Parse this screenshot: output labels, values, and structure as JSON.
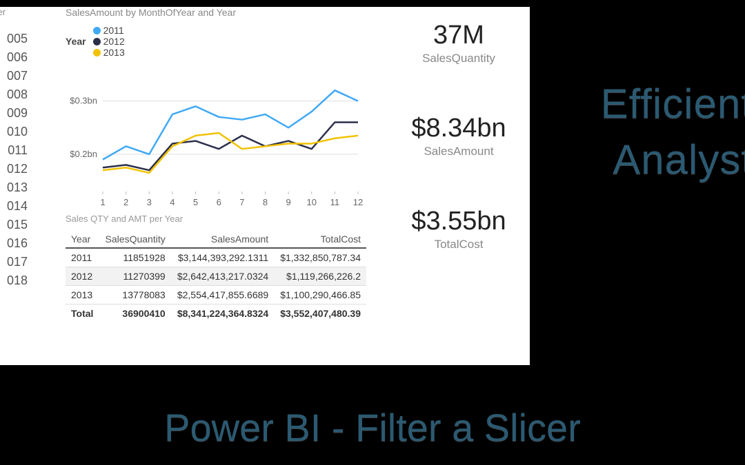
{
  "slicer": {
    "title": "cer",
    "years": [
      "005",
      "006",
      "007",
      "008",
      "009",
      "010",
      "011",
      "012",
      "013",
      "014",
      "015",
      "016",
      "017",
      "018"
    ]
  },
  "chart_title": "SalesAmount by MonthOfYear and Year",
  "legend": {
    "label": "Year",
    "items": [
      "2011",
      "2012",
      "2013"
    ]
  },
  "chart_data": {
    "type": "line",
    "x": [
      1,
      2,
      3,
      4,
      5,
      6,
      7,
      8,
      9,
      10,
      11,
      12
    ],
    "series": [
      {
        "name": "2011",
        "color": "#3fa9f5",
        "values": [
          0.19,
          0.215,
          0.2,
          0.275,
          0.29,
          0.27,
          0.265,
          0.275,
          0.25,
          0.28,
          0.32,
          0.3
        ]
      },
      {
        "name": "2012",
        "color": "#2b2f4a",
        "values": [
          0.175,
          0.18,
          0.17,
          0.22,
          0.225,
          0.21,
          0.235,
          0.215,
          0.225,
          0.21,
          0.26,
          0.26
        ]
      },
      {
        "name": "2013",
        "color": "#f2c200",
        "values": [
          0.17,
          0.175,
          0.165,
          0.215,
          0.235,
          0.24,
          0.21,
          0.215,
          0.22,
          0.22,
          0.23,
          0.235
        ]
      }
    ],
    "title": "SalesAmount by MonthOfYear and Year",
    "xlabel": "",
    "ylabel": "",
    "yticks": [
      "$0.2bn",
      "$0.3bn"
    ],
    "ylim": [
      0.13,
      0.35
    ]
  },
  "table": {
    "title": "Sales QTY and AMT per Year",
    "columns": [
      "Year",
      "SalesQuantity",
      "SalesAmount",
      "TotalCost"
    ],
    "rows": [
      {
        "Year": "2011",
        "SalesQuantity": "11851928",
        "SalesAmount": "$3,144,393,292.1311",
        "TotalCost": "$1,332,850,787.34"
      },
      {
        "Year": "2012",
        "SalesQuantity": "11270399",
        "SalesAmount": "$2,642,413,217.0324",
        "TotalCost": "$1,119,266,226.2"
      },
      {
        "Year": "2013",
        "SalesQuantity": "13778083",
        "SalesAmount": "$2,554,417,855.6689",
        "TotalCost": "$1,100,290,466.85"
      }
    ],
    "total": {
      "Year": "Total",
      "SalesQuantity": "36900410",
      "SalesAmount": "$8,341,224,364.8324",
      "TotalCost": "$3,552,407,480.39"
    }
  },
  "kpis": [
    {
      "value": "37M",
      "label": "SalesQuantity"
    },
    {
      "value": "$8.34bn",
      "label": "SalesAmount"
    },
    {
      "value": "$3.55bn",
      "label": "TotalCost"
    }
  ],
  "brand": {
    "line1": "Efficient",
    "line2": "Analyst"
  },
  "footer": "Power BI - Filter a Slicer"
}
